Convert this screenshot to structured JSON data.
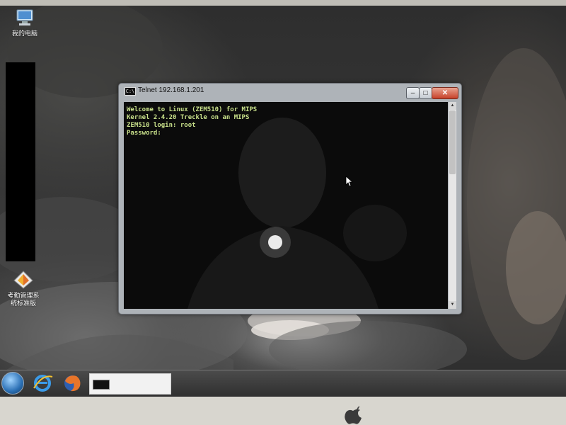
{
  "desktop": {
    "icons": [
      {
        "label": "我的电脑",
        "icon": "computer-icon"
      },
      {
        "label": "考勤管理系统标准版",
        "line1": "考勤管理系",
        "line2": "统标准版",
        "icon": "attendance-app-icon"
      }
    ]
  },
  "window": {
    "title": "Telnet 192.168.1.201",
    "icon": "command-prompt-icon",
    "controls": {
      "minimize": "–",
      "maximize": "□",
      "close": "✕"
    }
  },
  "console": {
    "lines": [
      "Welcome to Linux (ZEM510) for MIPS",
      "Kernel 2.4.20 Treckle on an MIPS",
      "ZEM510 login: root",
      "Password:"
    ],
    "text_color": "#c8e08a"
  },
  "taskbar": {
    "start_icon": "windows-start-icon",
    "pinned": [
      "internet-explorer-icon",
      "firefox-icon"
    ],
    "active_task_icon": "telnet-task-icon"
  }
}
